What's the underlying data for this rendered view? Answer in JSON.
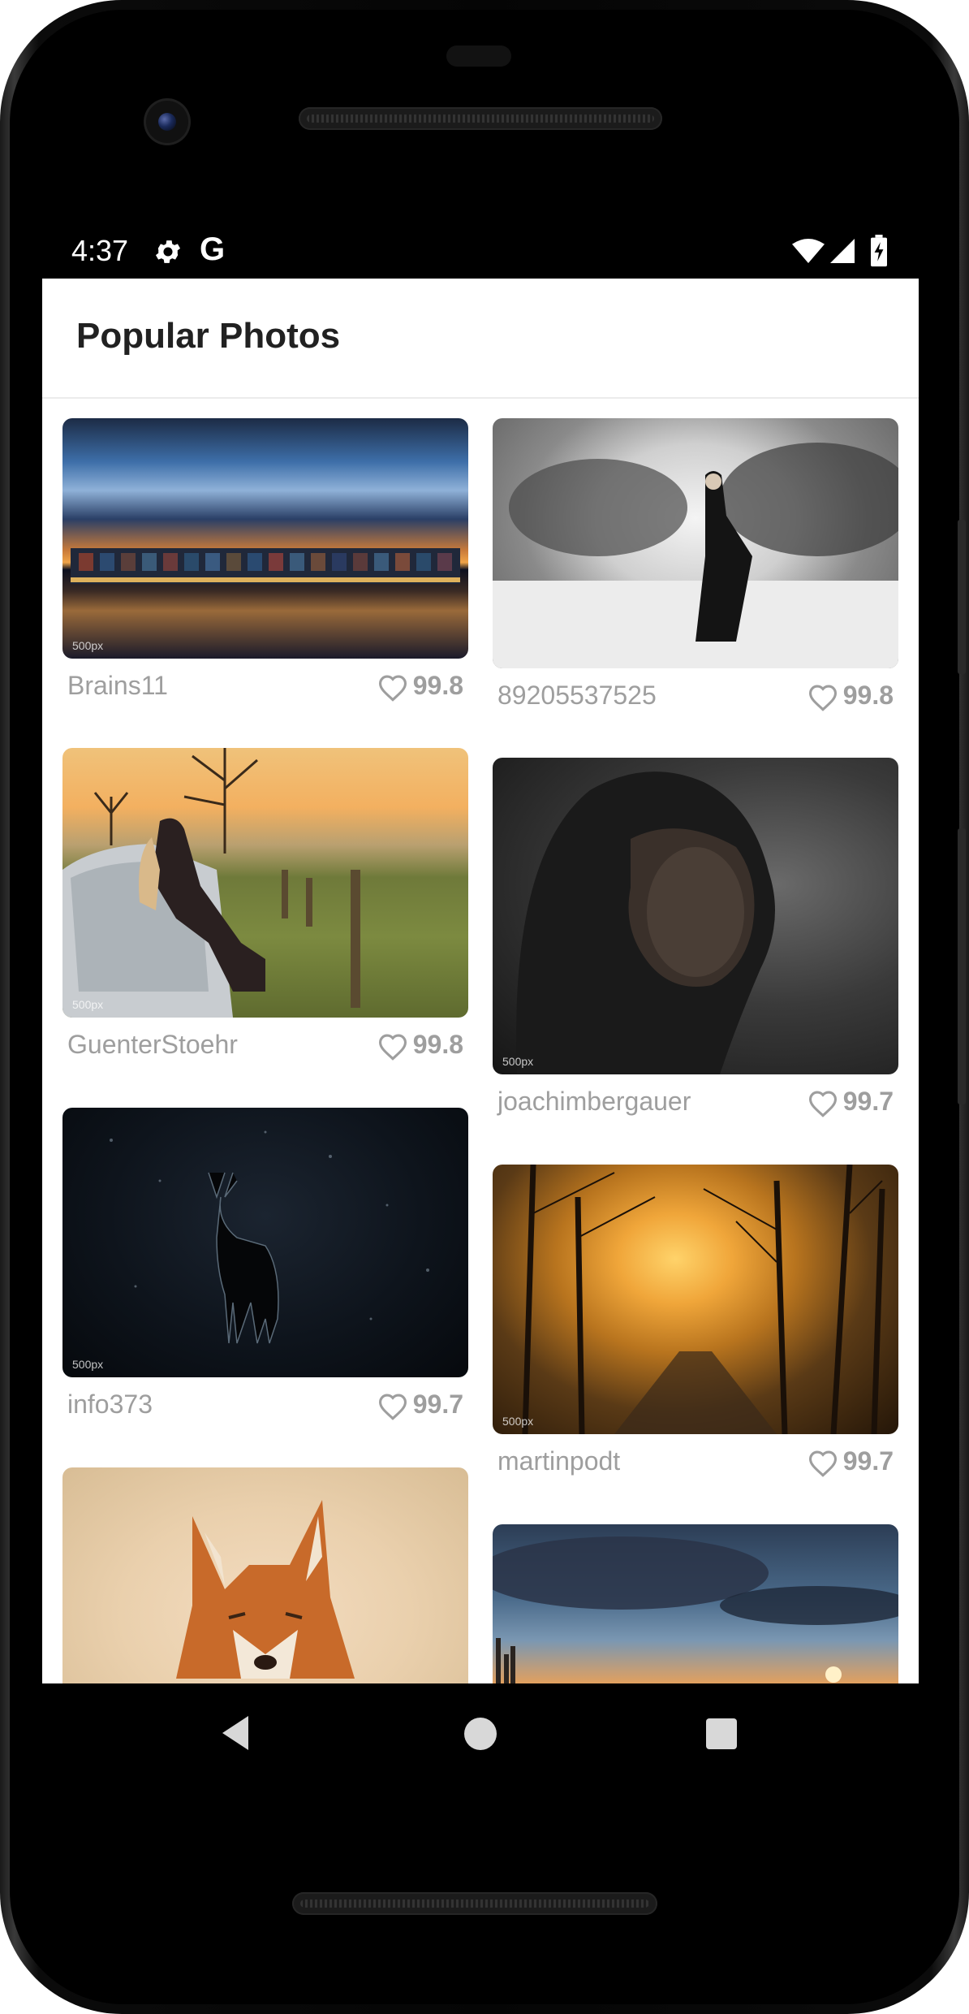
{
  "status_bar": {
    "time": "4:37",
    "left_icons": [
      "gear-icon",
      "google-g-icon"
    ],
    "right_icons": [
      "wifi-icon",
      "signal-icon",
      "battery-charging-icon"
    ],
    "google_glyph": "G"
  },
  "app_bar": {
    "title": "Popular Photos"
  },
  "photos": [
    {
      "user": "Brains11",
      "score": "99.8",
      "watermark": "500px"
    },
    {
      "user": "89205537525",
      "score": "99.8",
      "watermark": ""
    },
    {
      "user": "GuenterStoehr",
      "score": "99.8",
      "watermark": "500px"
    },
    {
      "user": "joachimbergauer",
      "score": "99.7",
      "watermark": "500px"
    },
    {
      "user": "info373",
      "score": "99.7",
      "watermark": "500px"
    },
    {
      "user": "martinpodt",
      "score": "99.7",
      "watermark": "500px"
    },
    {
      "user": "",
      "score": "",
      "watermark": ""
    },
    {
      "user": "",
      "score": "",
      "watermark": ""
    }
  ],
  "icons": {
    "like": "heart-outline-icon"
  },
  "nav_bar": {
    "buttons": [
      "back-icon",
      "home-icon",
      "recents-icon"
    ]
  },
  "colors": {
    "screen_bg": "#ffffff",
    "title_text": "#212121",
    "meta_text": "#9e9e9e",
    "bars_bg": "#000000"
  }
}
